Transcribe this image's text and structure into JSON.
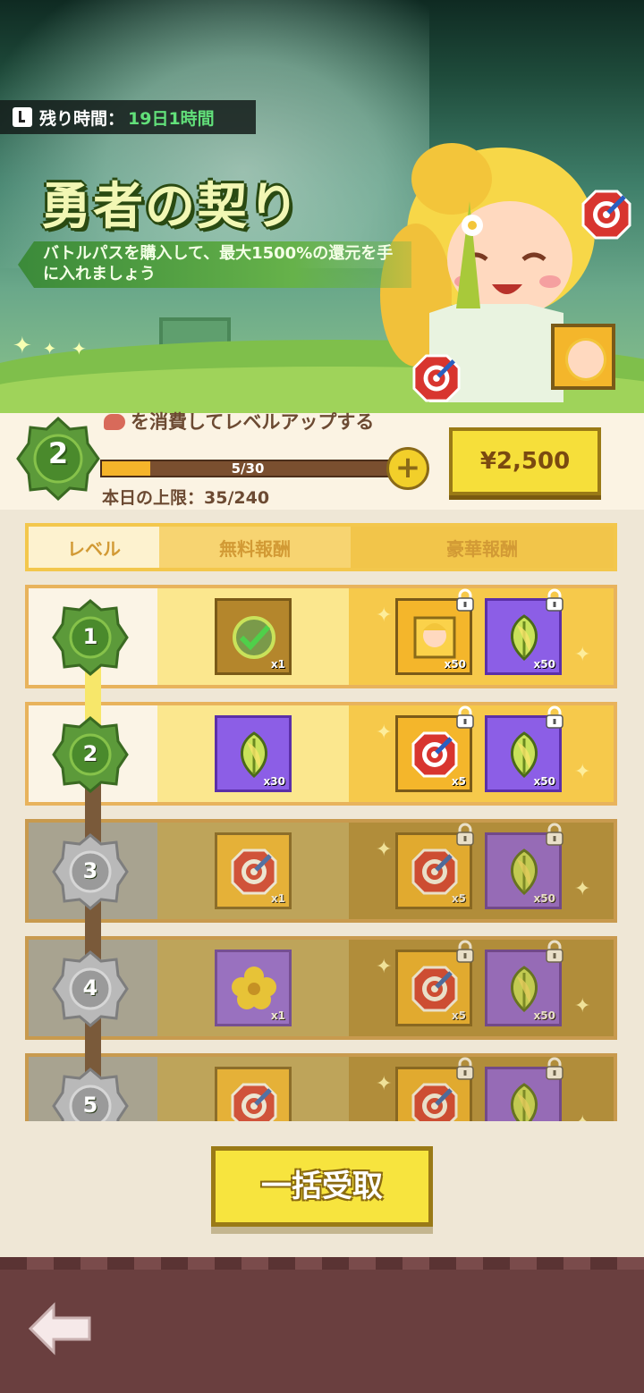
{
  "timer": {
    "label": "残り時間：",
    "value": "19日1時間"
  },
  "banner": {
    "title": "勇者の契り",
    "description": "バトルパスを購入して、最大1500%の還元を手に入れましょう"
  },
  "level": {
    "current": "2",
    "consume_text": "を消費してレベルアップする",
    "progress_text": "5/30",
    "progress_fraction": 0.1667,
    "daily_limit": "本日の上限：35/240",
    "price": "¥2,500"
  },
  "columns": {
    "level": "レベル",
    "free": "無料報酬",
    "lux": "豪華報酬"
  },
  "rows": [
    {
      "level": "1",
      "state": "active",
      "free": {
        "icon": "quest-check-icon",
        "qty": "x1"
      },
      "lux": [
        {
          "icon": "hero-shard-icon",
          "qty": "x50"
        },
        {
          "icon": "leaf-icon",
          "qty": "x50"
        }
      ]
    },
    {
      "level": "2",
      "state": "active",
      "free": {
        "icon": "leaf-icon",
        "qty": "x30"
      },
      "lux": [
        {
          "icon": "target-icon",
          "qty": "x5"
        },
        {
          "icon": "leaf-icon",
          "qty": "x50"
        }
      ]
    },
    {
      "level": "3",
      "state": "locked",
      "free": {
        "icon": "target-icon",
        "qty": "x1"
      },
      "lux": [
        {
          "icon": "target-icon",
          "qty": "x5"
        },
        {
          "icon": "leaf-icon",
          "qty": "x50"
        }
      ]
    },
    {
      "level": "4",
      "state": "locked",
      "free": {
        "icon": "flower-icon",
        "qty": "x1"
      },
      "lux": [
        {
          "icon": "target-icon",
          "qty": "x5"
        },
        {
          "icon": "leaf-icon",
          "qty": "x50"
        }
      ]
    },
    {
      "level": "5",
      "state": "locked",
      "free": {
        "icon": "target-icon",
        "qty": ""
      },
      "lux": [
        {
          "icon": "target-icon",
          "qty": ""
        },
        {
          "icon": "leaf-icon",
          "qty": ""
        }
      ]
    }
  ],
  "claim_all": "一括受取",
  "colors": {
    "accent": "#f6df3a",
    "green": "#62e07a",
    "brown": "#6a3f3f"
  }
}
